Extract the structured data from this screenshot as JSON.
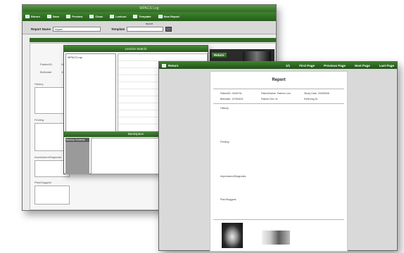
{
  "back_window": {
    "title": "MPACS Log",
    "toolbar": [
      {
        "label": "Return",
        "icon": "return-icon"
      },
      {
        "label": "Save",
        "icon": "save-icon"
      },
      {
        "label": "Preview",
        "icon": "preview-icon"
      },
      {
        "label": "Close",
        "icon": "close-icon"
      },
      {
        "label": "Lexicon",
        "icon": "lexicon-icon"
      },
      {
        "label": "Template",
        "icon": "template-icon"
      },
      {
        "label": "New Report",
        "icon": "new-report-icon"
      }
    ],
    "report_label": "report",
    "report_name_label": "Report Name",
    "report_name_value": "report",
    "template_label": "Template",
    "patient_id_label": "PatientID:",
    "patient_id_value": "00",
    "birthdate_label": "Birthdate:",
    "birthdate_value": "19",
    "history_label": "History",
    "finding_label": "Finding",
    "impression_label": "Impression/Diagnosis",
    "plan_label": "Plan/Suggest"
  },
  "lexicon_window": {
    "title": "Lexicon Search",
    "tree_root": "MPACS-ray",
    "backspace_title": "Backspace",
    "backspace_tab": "Backup Contents"
  },
  "thumb_window": {
    "return_label": "Return"
  },
  "report_window": {
    "return_label": "Return",
    "page_indicator": "1/1",
    "first_page": "First Page",
    "previous_page": "Previous Page",
    "next_page": "Next Page",
    "last_page": "Last Page",
    "report_title": "Report",
    "patient_id": "PatientID: 0005751",
    "patient_name": "PatientName: Patient Lum",
    "study_date": "Study Date: 20090608",
    "birthdate": "Birthdate: 19750403",
    "patient_sex": "Patient Sex: M",
    "referring_dr": "Referring Dr",
    "history_label": "History",
    "finding_label": "Finding",
    "impression_label": "Impression/Diagnosis",
    "plan_label": "Plan/Suggest",
    "accent": "#2f6a22"
  }
}
